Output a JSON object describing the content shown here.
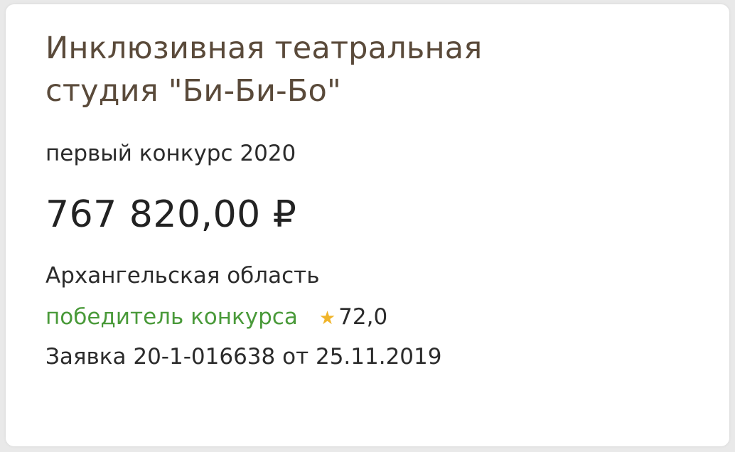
{
  "project": {
    "title_line1": "Инклюзивная театральная",
    "title_line2": "студия \"Би-Би-Бо\"",
    "contest": "первый конкурс 2020",
    "amount": "767 820,00 ₽",
    "region": "Архангельская область",
    "status": "победитель конкурса",
    "rating_icon": "star-icon",
    "rating": "72,0",
    "application": "Заявка 20-1-016638 от 25.11.2019"
  },
  "colors": {
    "title": "#5a4a3a",
    "status": "#4a9a3a",
    "star": "#f0b429"
  }
}
